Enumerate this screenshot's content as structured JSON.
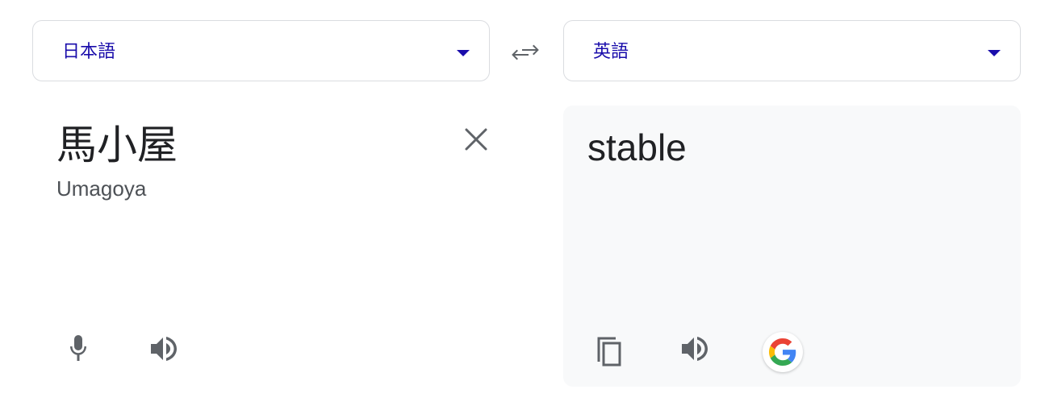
{
  "source_language": {
    "label": "日本語",
    "accent_color": "#1a0dab"
  },
  "target_language": {
    "label": "英語",
    "accent_color": "#1a0dab"
  },
  "swap": {
    "icon": "swap-arrows-icon"
  },
  "source": {
    "text": "馬小屋",
    "romanization": "Umagoya",
    "icons": [
      "close-icon",
      "microphone-icon",
      "speaker-icon"
    ]
  },
  "target": {
    "text": "stable",
    "icons": [
      "copy-icon",
      "speaker-icon",
      "google-logo-icon"
    ]
  }
}
